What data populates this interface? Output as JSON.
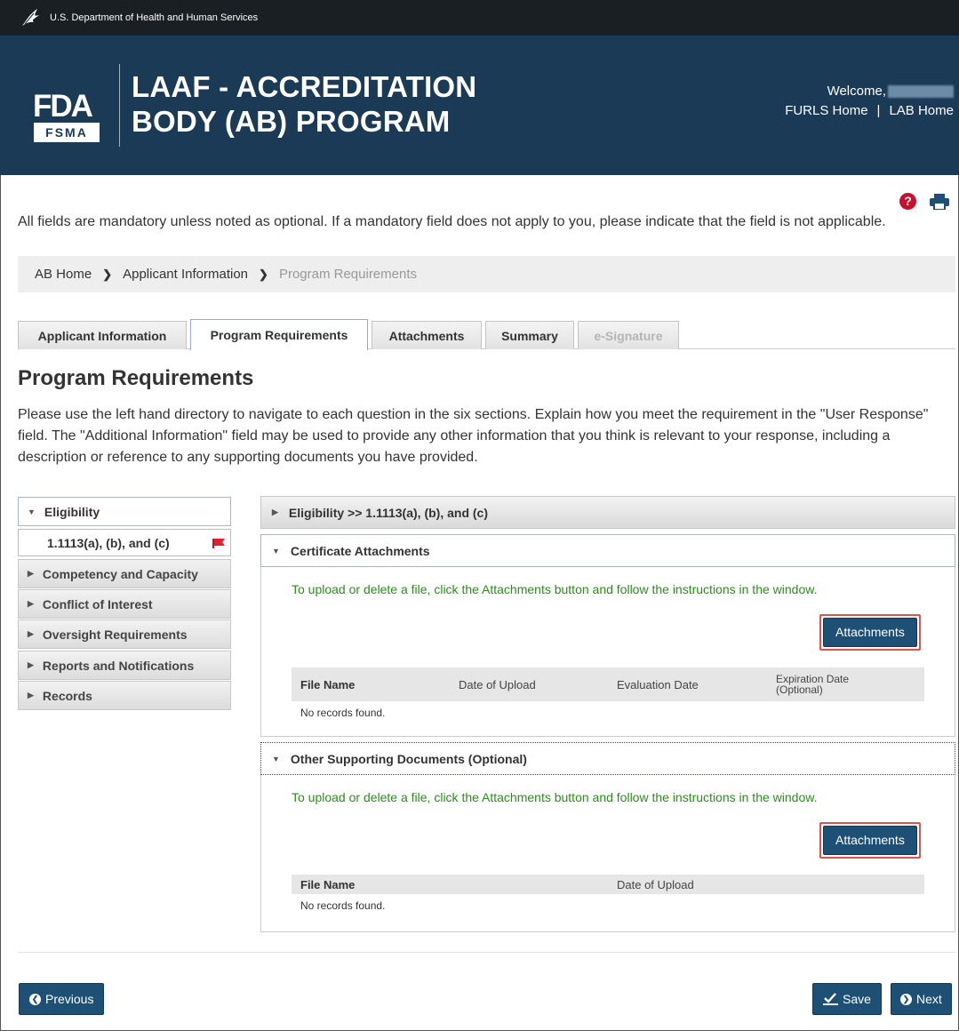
{
  "agency_bar": {
    "text": "U.S. Department of Health and Human Services"
  },
  "header": {
    "logo_fda": "FDA",
    "logo_fsma": "FSMA",
    "title_line1": "LAAF - ACCREDITATION",
    "title_line2": "BODY (AB) PROGRAM",
    "welcome": "Welcome,",
    "links": [
      "FURLS Home",
      "LAB Home"
    ]
  },
  "mandatory_note": "All fields are mandatory unless noted as optional. If a mandatory field does not apply to you, please indicate that the field is not applicable.",
  "breadcrumb": [
    "AB Home",
    "Applicant Information",
    "Program Requirements"
  ],
  "tabs": [
    {
      "label": "Applicant Information",
      "state": "normal"
    },
    {
      "label": "Program Requirements",
      "state": "active"
    },
    {
      "label": "Attachments",
      "state": "normal"
    },
    {
      "label": "Summary",
      "state": "normal"
    },
    {
      "label": "e-Signature",
      "state": "disabled"
    }
  ],
  "page_title": "Program Requirements",
  "intro": "Please use the left hand directory to navigate to each question in the six sections. Explain how you meet the requirement in the \"User Response\" field. The \"Additional Information\" field may be used to provide any other information that you think is relevant to your response, including a description or reference to any supporting documents you have provided.",
  "sidebar": {
    "sections": [
      {
        "label": "Eligibility",
        "open": true
      },
      {
        "label": "1.1113(a), (b), and (c)",
        "sub": true,
        "flag": "red-flag-icon"
      },
      {
        "label": "Competency and Capacity"
      },
      {
        "label": "Conflict of Interest"
      },
      {
        "label": "Oversight Requirements"
      },
      {
        "label": "Reports and Notifications"
      },
      {
        "label": "Records"
      }
    ]
  },
  "panels": {
    "eligibility": {
      "title": "Eligibility >> 1.1113(a), (b), and (c)"
    },
    "certificate": {
      "title": "Certificate Attachments",
      "instruction": "To upload or delete a file, click the Attachments button and follow the instructions in the window.",
      "button": "Attachments",
      "columns": [
        "File Name",
        "Date of Upload",
        "Evaluation Date",
        "Expiration Date (Optional)"
      ],
      "empty": "No records found."
    },
    "other": {
      "title": "Other Supporting Documents (Optional)",
      "instruction": "To upload or delete a file, click the Attachments button and follow the instructions in the window.",
      "button": "Attachments",
      "columns": [
        "File Name",
        "Date of Upload"
      ],
      "empty": "No records found."
    }
  },
  "footer": {
    "previous": "Previous",
    "save": "Save",
    "next": "Next"
  },
  "colors": {
    "header_bg": "#1b3a56",
    "agency_bar_bg": "#1a1f24",
    "button_bg": "#1e4f75",
    "instruction_green": "#2e8b1f",
    "highlight_red": "#d9534f"
  }
}
